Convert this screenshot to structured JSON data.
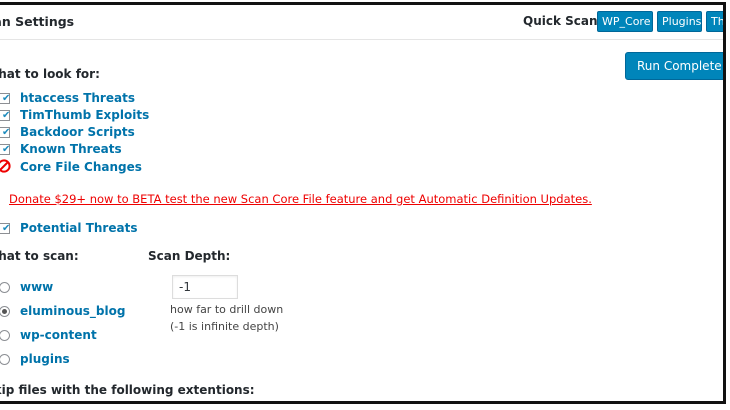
{
  "panel": {
    "title": "Scan Settings"
  },
  "quick_scan": {
    "label": "Quick Scan:",
    "buttons": [
      "WP_Core",
      "Plugins",
      "Themes"
    ]
  },
  "run_button": {
    "label": "Run Complete Scan"
  },
  "look_for": {
    "heading": "What to look for:",
    "items": [
      {
        "label": "htaccess Threats",
        "checked": true
      },
      {
        "label": "TimThumb Exploits",
        "checked": true
      },
      {
        "label": "Backdoor Scripts",
        "checked": true
      },
      {
        "label": "Known Threats",
        "checked": true
      },
      {
        "label": "Core File Changes",
        "disabled_icon": "forbidden-icon"
      }
    ]
  },
  "donate_link": "Donate $29+ now to BETA test the new Scan Core File feature and get Automatic Definition Updates.",
  "potential_threats": {
    "label": "Potential Threats",
    "checked": true
  },
  "what_to_scan": {
    "heading": "What to scan:",
    "options": [
      {
        "label": "www",
        "selected": false
      },
      {
        "label": "eluminous_blog",
        "selected": true
      },
      {
        "label": "wp-content",
        "selected": false
      },
      {
        "label": "plugins",
        "selected": false
      }
    ]
  },
  "scan_depth": {
    "heading": "Scan Depth:",
    "value": "-1",
    "hint_line1": "how far to drill down",
    "hint_line2": "(-1 is infinite depth)"
  },
  "skip_files": {
    "heading": "Skip files with the following extentions:"
  },
  "colors": {
    "link": "#0073aa",
    "button": "#0085ba",
    "danger": "#ee0000"
  }
}
